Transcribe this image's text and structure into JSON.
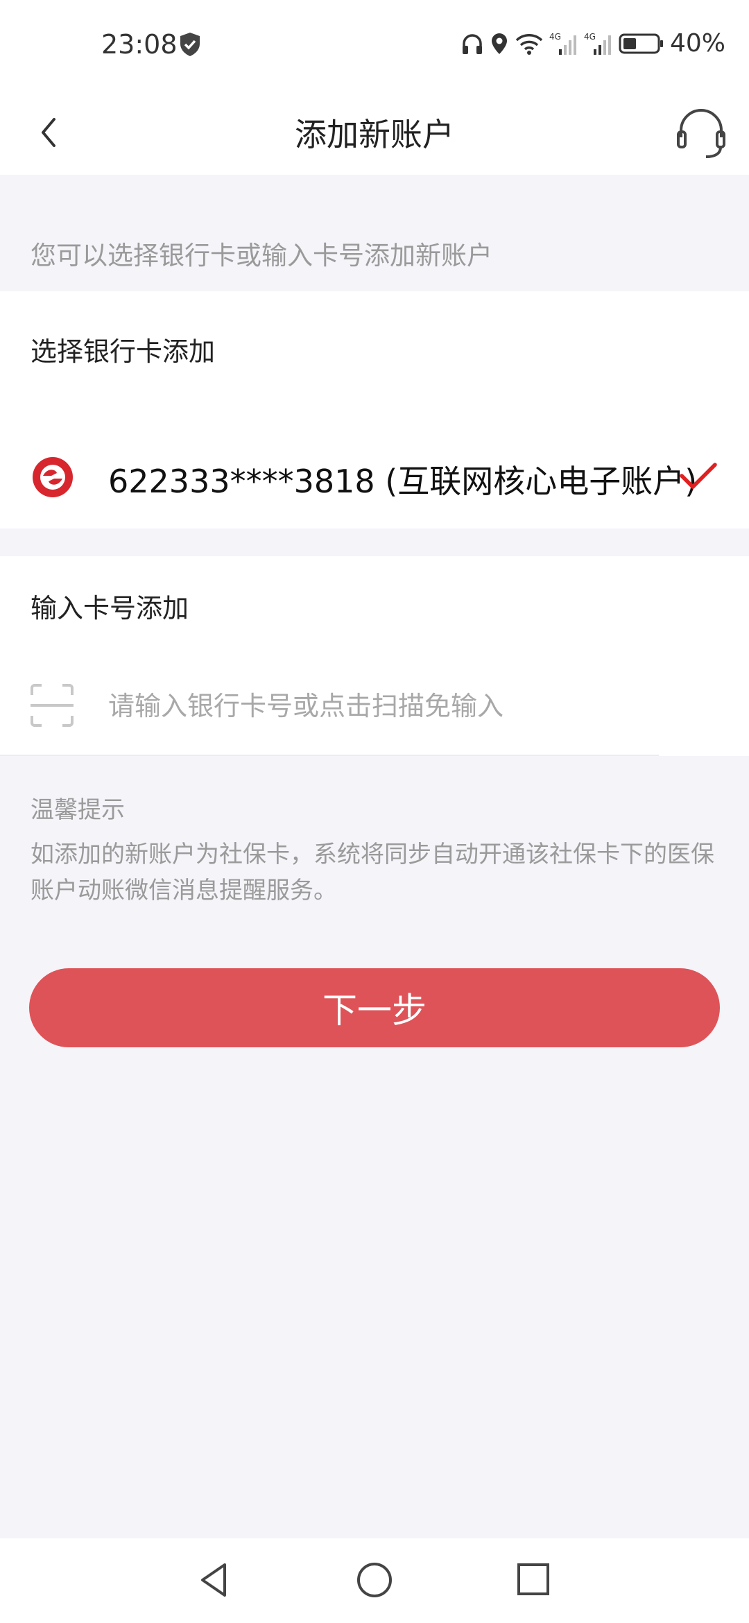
{
  "status_bar": {
    "time": "23:08",
    "battery": "40%",
    "network_1": "4G",
    "network_2": "4G",
    "icons": [
      "shield-icon",
      "headphones-icon",
      "location-icon",
      "wifi-icon",
      "signal-icon",
      "battery-icon"
    ]
  },
  "header": {
    "title": "添加新账户",
    "back_icon": "chevron-left-icon",
    "service_icon": "headset-icon"
  },
  "hint": "您可以选择银行卡或输入卡号添加新账户",
  "select_card": {
    "title": "选择银行卡添加",
    "card_label": "622333****3818 (互联网核心电子账户)",
    "selected": true,
    "brand_color": "#d8262e"
  },
  "input_card": {
    "title": "输入卡号添加",
    "placeholder": "请输入银行卡号或点击扫描免输入",
    "value": ""
  },
  "tips": {
    "title": "温馨提示",
    "body": "如添加的新账户为社保卡，系统将同步自动开通该社保卡下的医保账户动账微信消息提醒服务。"
  },
  "next_button": {
    "label": "下一步",
    "color": "#de5358"
  },
  "system_nav": {
    "icons": [
      "back-triangle-icon",
      "home-circle-icon",
      "recents-square-icon"
    ]
  }
}
